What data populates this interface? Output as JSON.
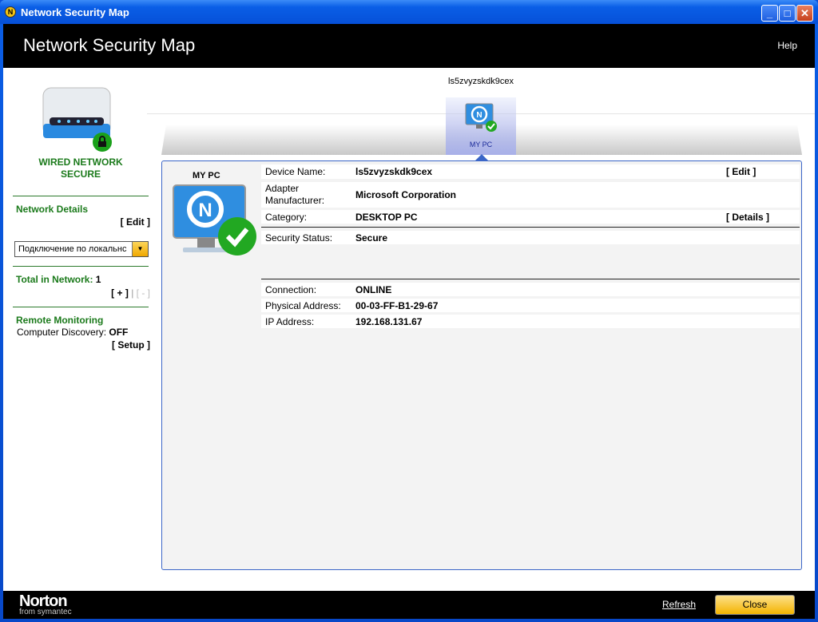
{
  "window": {
    "title": "Network Security Map"
  },
  "header": {
    "title": "Network Security Map",
    "help": "Help"
  },
  "left": {
    "status_line1": "WIRED NETWORK",
    "status_line2": "SECURE",
    "network_details": "Network Details",
    "edit": "[ Edit ]",
    "connection_select": "Подключение по локальнс",
    "total_label": "Total in Network:",
    "total_value": "1",
    "add": "[ + ]",
    "divider": "|",
    "remove": "[ - ]",
    "remote_monitoring": "Remote Monitoring",
    "discovery_label": "Computer Discovery:",
    "discovery_value": "OFF",
    "setup": "[ Setup ]"
  },
  "map": {
    "hostname": "ls5zvyzskdk9cex",
    "device_label": "MY PC"
  },
  "details": {
    "title": "MY PC",
    "rows": [
      {
        "key": "Device Name:",
        "value": "ls5zvyzskdk9cex",
        "action": "[ Edit ]"
      },
      {
        "key1": "Adapter",
        "key2": "Manufacturer:",
        "value": "Microsoft Corporation"
      },
      {
        "key": "Category:",
        "value": "DESKTOP PC",
        "action": "[ Details ]"
      },
      {
        "key": "Security Status:",
        "value": "Secure"
      },
      {
        "key": "Connection:",
        "value": "ONLINE"
      },
      {
        "key": "Physical Address:",
        "value": "00-03-FF-B1-29-67"
      },
      {
        "key": "IP Address:",
        "value": "192.168.131.67"
      }
    ]
  },
  "footer": {
    "brand": "Norton",
    "brand_sub": "from symantec",
    "refresh": "Refresh",
    "close": "Close"
  }
}
